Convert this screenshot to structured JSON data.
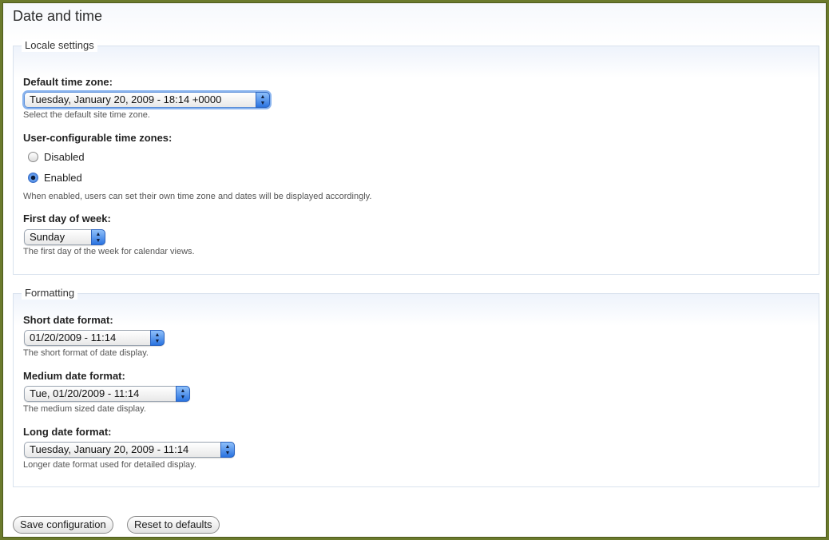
{
  "page": {
    "title": "Date and time"
  },
  "locale": {
    "legend": "Locale settings",
    "timezone": {
      "label": "Default time zone:",
      "value": "Tuesday, January 20, 2009 - 18:14 +0000",
      "description": "Select the default site time zone."
    },
    "user_tz": {
      "label": "User-configurable time zones:",
      "options": [
        "Disabled",
        "Enabled"
      ],
      "selected": "Enabled",
      "description": "When enabled, users can set their own time zone and dates will be displayed accordingly."
    },
    "first_day": {
      "label": "First day of week:",
      "value": "Sunday",
      "description": "The first day of the week for calendar views."
    }
  },
  "formatting": {
    "legend": "Formatting",
    "short": {
      "label": "Short date format:",
      "value": "01/20/2009 - 11:14",
      "description": "The short format of date display."
    },
    "medium": {
      "label": "Medium date format:",
      "value": "Tue, 01/20/2009 - 11:14",
      "description": "The medium sized date display."
    },
    "long": {
      "label": "Long date format:",
      "value": "Tuesday, January 20, 2009 - 11:14",
      "description": "Longer date format used for detailed display."
    }
  },
  "buttons": {
    "save": "Save configuration",
    "reset": "Reset to defaults"
  },
  "icons": {
    "select_arrow": "up-down-arrows-icon"
  },
  "colors": {
    "frame": "#6b7a2c",
    "select_accent": "#2a73e0"
  }
}
